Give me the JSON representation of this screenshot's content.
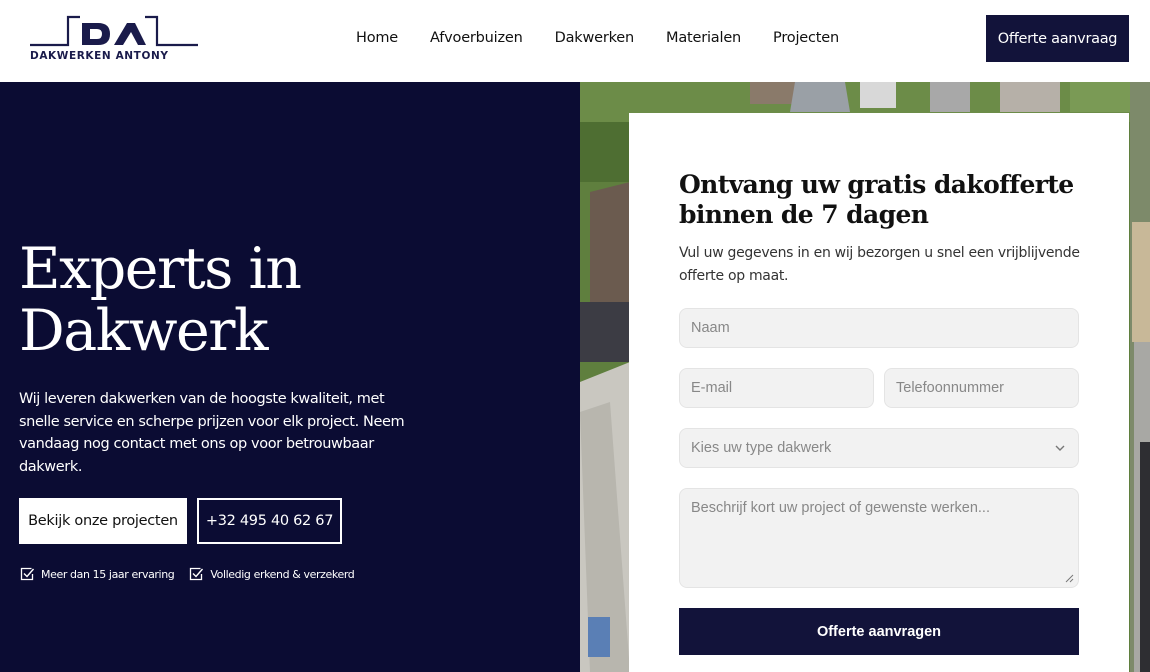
{
  "brand": {
    "logo_mark": "DA",
    "logo_text": "DAKWERKEN ANTONY",
    "primary_color": "#12133a",
    "hero_bg": "#0b0c33"
  },
  "nav": {
    "items": [
      "Home",
      "Afvoerbuizen",
      "Dakwerken",
      "Materialen",
      "Projecten"
    ]
  },
  "header": {
    "cta_label": "Offerte aanvraag"
  },
  "hero": {
    "title": "Experts in Dakwerk",
    "description": "Wij leveren dakwerken van de hoogste kwaliteit, met snelle service en scherpe prijzen voor elk project. Neem vandaag nog contact met ons op voor betrouwbaar dakwerk.",
    "btn_projects": "Bekijk onze projecten",
    "btn_phone": "+32 495 40 62 67",
    "checks": [
      "Meer dan 15 jaar ervaring",
      "Volledig erkend & verzekerd"
    ]
  },
  "form": {
    "title": "Ontvang uw gratis dakofferte binnen de 7 dagen",
    "subtitle": "Vul uw gegevens in en wij bezorgen u snel een vrijblijvende offerte op maat.",
    "name_placeholder": "Naam",
    "email_placeholder": "E-mail",
    "phone_placeholder": "Telefoonnummer",
    "select_placeholder": "Kies uw type dakwerk",
    "message_placeholder": "Beschrijf kort uw project of gewenste werken...",
    "submit_label": "Offerte aanvragen"
  },
  "icons": {
    "check": "check-square-icon",
    "select": "chevron-down-icon",
    "resize": "resize-grip-icon"
  }
}
